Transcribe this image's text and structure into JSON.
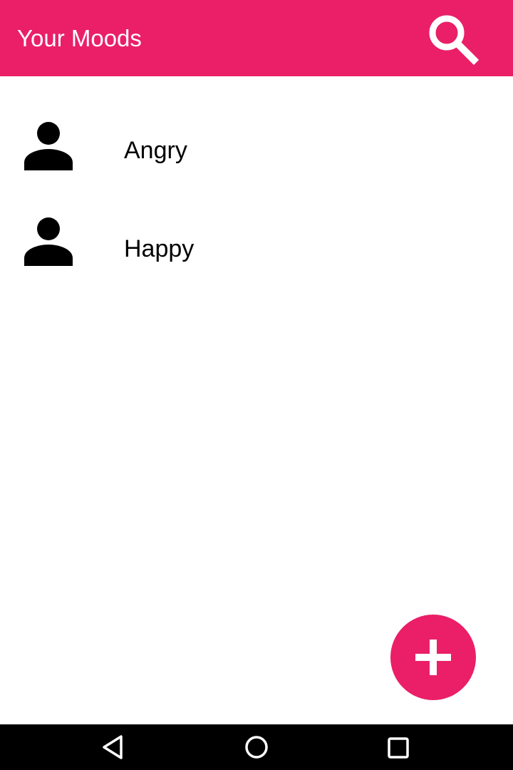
{
  "app_bar": {
    "title": "Your Moods",
    "background_color": "#ea1f67",
    "search_icon": "search-icon"
  },
  "moods": [
    {
      "label": "Angry",
      "icon": "person-icon"
    },
    {
      "label": "Happy",
      "icon": "person-icon"
    }
  ],
  "fab": {
    "icon": "plus-icon",
    "color": "#ea1f67"
  },
  "nav_bar": {
    "buttons": [
      "back-icon",
      "home-icon",
      "recents-icon"
    ]
  }
}
